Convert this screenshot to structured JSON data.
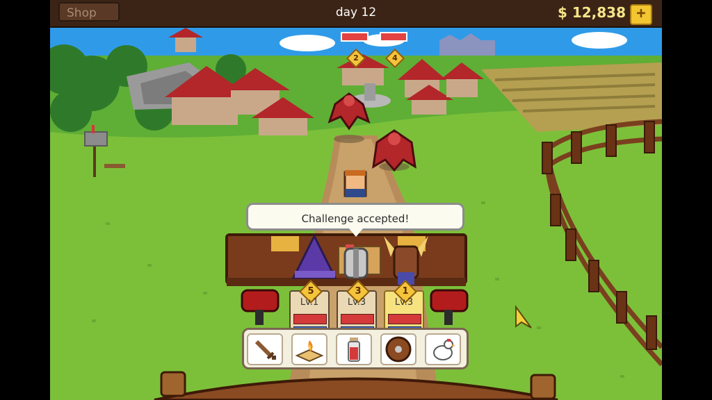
{
  "topbar": {
    "shop_label": "Shop",
    "day_label": "day 12",
    "money": "$ 12,838",
    "plus_icon": "+"
  },
  "dialog": {
    "text": "Challenge accepted!"
  },
  "enemies": [
    {
      "name": "red-bat",
      "level": "2"
    },
    {
      "name": "red-bat",
      "level": "4"
    }
  ],
  "party": [
    {
      "class": "mage",
      "level_badge": "5",
      "level_label": "Lv.1"
    },
    {
      "class": "knight",
      "level_badge": "3",
      "level_label": "Lv.3"
    },
    {
      "class": "warrior",
      "level_badge": "1",
      "level_label": "Lv.3"
    }
  ],
  "actions": [
    {
      "icon": "sword-icon"
    },
    {
      "icon": "fire-spellbook-icon"
    },
    {
      "icon": "red-potion-icon"
    },
    {
      "icon": "round-shield-icon"
    },
    {
      "icon": "chicken-icon"
    }
  ],
  "colors": {
    "hp": "#d43a3a",
    "mp": "#3f6fd6",
    "gold": "#f4c43a",
    "grass": "#8cc63f"
  }
}
